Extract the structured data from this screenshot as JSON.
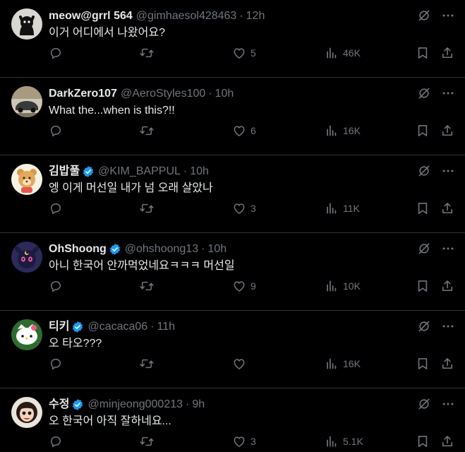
{
  "tweets": [
    {
      "name": "meow@grrl 564",
      "handle": "@gimhaesol428463",
      "time": "12h",
      "text": "이거 어디에서 나왔어요?",
      "replies": "",
      "retweets": "",
      "likes": "5",
      "views": "46K",
      "verified": false,
      "avatar": "black-cat-avatar"
    },
    {
      "name": "DarkZero107",
      "handle": "@AeroStyles100",
      "time": "10h",
      "text": "What the...when is this?!!",
      "replies": "",
      "retweets": "",
      "likes": "6",
      "views": "16K",
      "verified": false,
      "avatar": "car-photo-avatar"
    },
    {
      "name": "김밥풀",
      "handle": "@KIM_BAPPUL",
      "time": "10h",
      "text": "엥 이게 머선일 내가 넘 오래 살았나",
      "replies": "",
      "retweets": "",
      "likes": "3",
      "views": "11K",
      "verified": true,
      "avatar": "bear-avatar"
    },
    {
      "name": "OhShoong",
      "handle": "@ohshoong13",
      "time": "10h",
      "text": "아니 한국어 안까먹었네요ㅋㅋㅋ 머선일",
      "replies": "",
      "retweets": "",
      "likes": "9",
      "views": "10K",
      "verified": true,
      "avatar": "luna-cat-avatar"
    },
    {
      "name": "티키",
      "handle": "@cacaca06",
      "time": "11h",
      "text": "오 타오???",
      "replies": "",
      "retweets": "",
      "likes": "",
      "views": "16K",
      "verified": true,
      "avatar": "kitty-avatar"
    },
    {
      "name": "수정",
      "handle": "@minjeong000213",
      "time": "9h",
      "text": "오 한국어 아직 잘하네요...",
      "replies": "",
      "retweets": "",
      "likes": "3",
      "views": "5.1K",
      "verified": true,
      "avatar": "girl-avatar"
    }
  ],
  "colors": {
    "background": "#000000",
    "text": "#e7e9ea",
    "muted": "#71767b",
    "verified": "#1d9bf0",
    "divider": "#2f3336"
  }
}
